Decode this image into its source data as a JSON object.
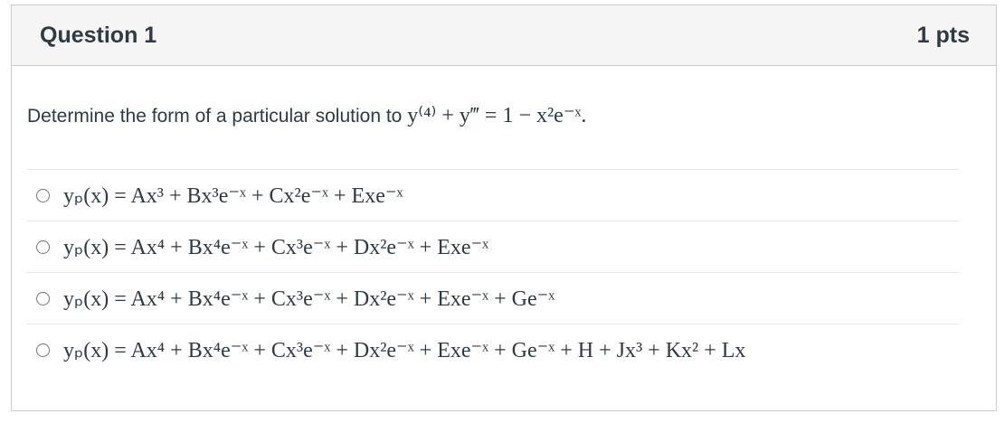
{
  "question": {
    "title": "Question 1",
    "points": "1 pts",
    "prompt_text": "Determine the form of a particular solution to",
    "prompt_equation": "y⁽⁴⁾ + y‴ = 1 − x²e⁻ˣ."
  },
  "answers": [
    {
      "label": "yₚ(x) = Ax³ + Bx³e⁻ˣ + Cx²e⁻ˣ + Exe⁻ˣ"
    },
    {
      "label": "yₚ(x) = Ax⁴ + Bx⁴e⁻ˣ + Cx³e⁻ˣ + Dx²e⁻ˣ + Exe⁻ˣ"
    },
    {
      "label": "yₚ(x) = Ax⁴ + Bx⁴e⁻ˣ + Cx³e⁻ˣ + Dx²e⁻ˣ + Exe⁻ˣ + Ge⁻ˣ"
    },
    {
      "label": "yₚ(x) = Ax⁴ + Bx⁴e⁻ˣ + Cx³e⁻ˣ + Dx²e⁻ˣ + Exe⁻ˣ + Ge⁻ˣ + H + Jx³ + Kx² + Lx"
    }
  ]
}
